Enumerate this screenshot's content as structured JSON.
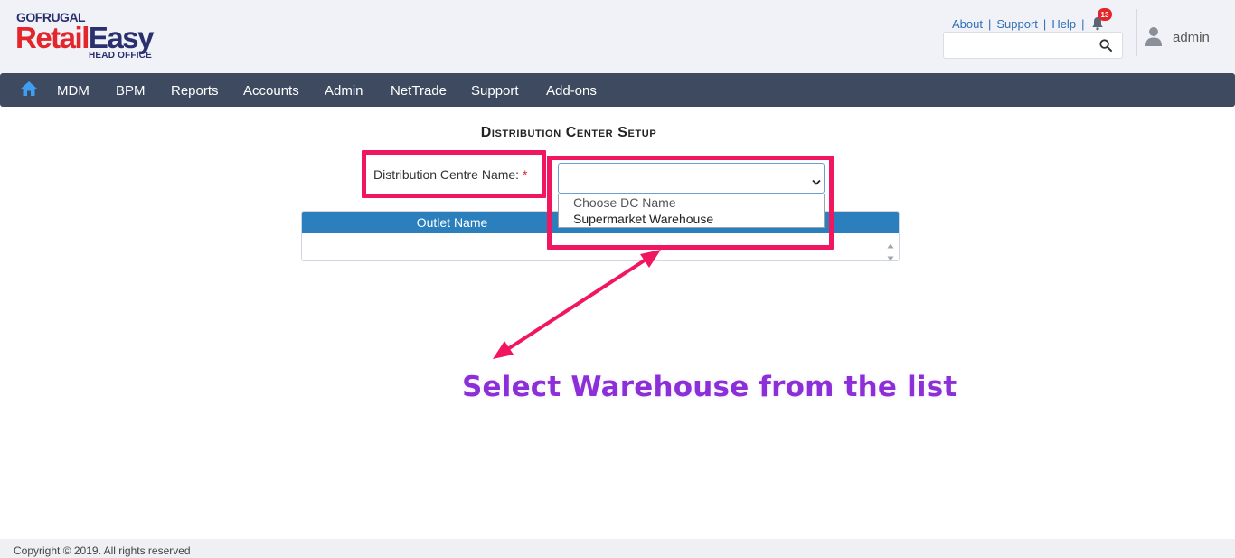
{
  "brand": {
    "gofrugal": "GOFRUGAL",
    "retail": "Retail",
    "easy": "Easy",
    "head_office": "HEAD OFFICE"
  },
  "toplinks": {
    "about": "About",
    "support": "Support",
    "help": "Help",
    "notification_count": "13"
  },
  "search": {
    "placeholder": ""
  },
  "user": {
    "name": "admin"
  },
  "nav": {
    "items": [
      "MDM",
      "BPM",
      "Reports",
      "Accounts",
      "Admin",
      "NetTrade",
      "Support",
      "Add-ons"
    ]
  },
  "page": {
    "title": "Distribution Center Setup",
    "field_label": "Distribution Centre Name:",
    "required_mark": "*",
    "select_value": "",
    "dropdown_options": [
      "Choose DC Name",
      "Supermarket Warehouse"
    ],
    "grid_headers": [
      "Outlet Name",
      ""
    ]
  },
  "annotation": {
    "text": "Select Warehouse from the list"
  },
  "footer": {
    "text": "Copyright © 2019. All rights reserved"
  },
  "colors": {
    "nav_bg": "#3d4a5f",
    "grid_header": "#2c7fbd",
    "highlight": "#f0165f",
    "annotation_text": "#8c2fd8",
    "brand_red": "#e3262b",
    "brand_navy": "#2a2f6e"
  }
}
